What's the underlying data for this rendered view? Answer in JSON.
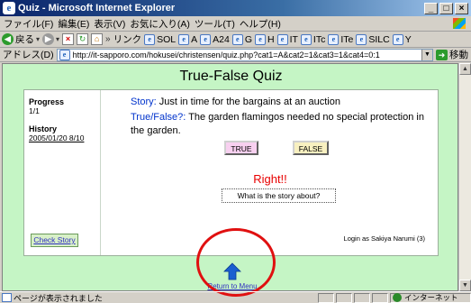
{
  "window": {
    "title": "Quiz - Microsoft Internet Explorer"
  },
  "menu": [
    "ファイル(F)",
    "編集(E)",
    "表示(V)",
    "お気に入り(A)",
    "ツール(T)",
    "ヘルプ(H)"
  ],
  "toolbar": {
    "back_label": "戻る",
    "links_label": "リンク",
    "links": [
      "SOL",
      "A",
      "A24",
      "G",
      "H",
      "IT",
      "ITc",
      "ITe",
      "SILC",
      "Y"
    ]
  },
  "address": {
    "label": "アドレス(D)",
    "url": "http://it-sapporo.com/hokusei/christensen/quiz.php?cat1=A&cat2=1&cat3=1&cat4=0:1",
    "go_label": "移動"
  },
  "quiz": {
    "title": "True-False Quiz",
    "progress_label": "Progress",
    "progress_value": "1/1",
    "history_label": "History",
    "history_value": "2005/01/20  8/10",
    "story_label": "Story:",
    "story_text": "Just in time for the bargains at an auction",
    "tf_label": "True/False?:",
    "tf_text": "The garden flamingos needed no special protection in the garden.",
    "true_button": "TRUE",
    "false_button": "FALSE",
    "result": "Right!!",
    "about_button": "What is the story about?",
    "check_story": "Check Story",
    "login": "Login as Sakiya Narumi (3)",
    "return_link": "Return to Menu"
  },
  "status": {
    "message": "ページが表示されました",
    "zone": "インターネット"
  }
}
